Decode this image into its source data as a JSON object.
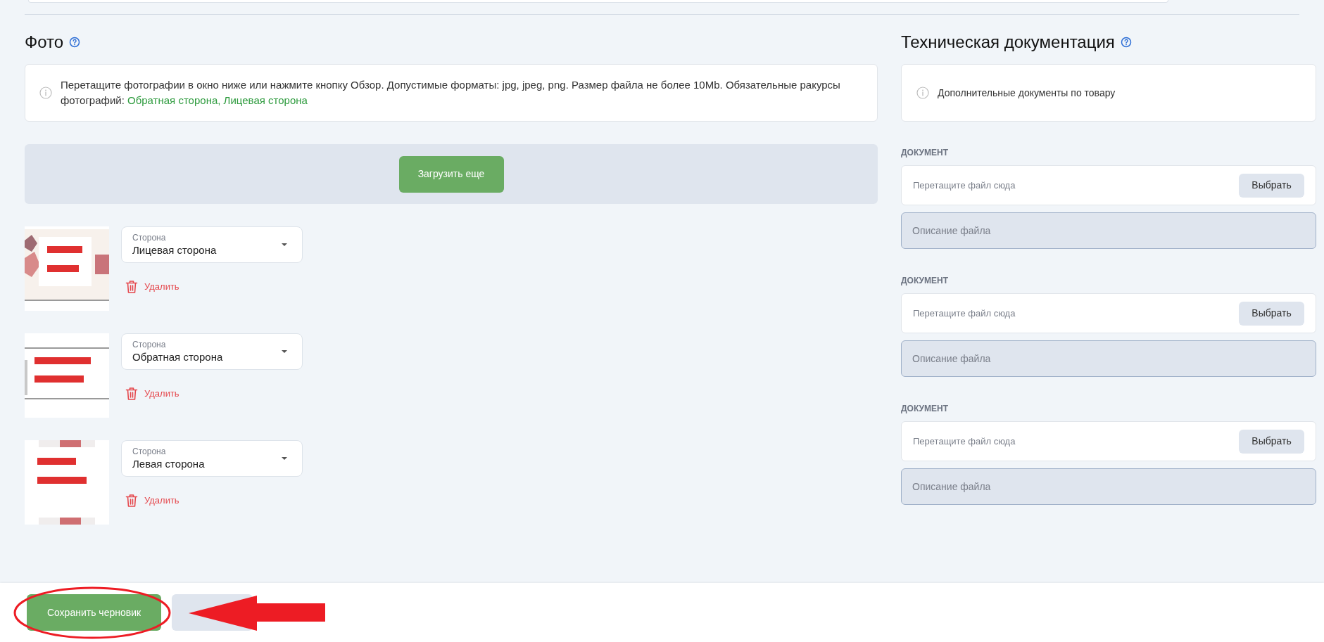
{
  "photo_section": {
    "title": "Фото",
    "info": "Перетащите фотографии в окно ниже или нажмите кнопку Обзор. Допустимые форматы: jpg, jpeg, png. Размер файла не более 10Mb. Обязательные ракурсы фотографий: ",
    "required_views": "Обратная сторона, Лицевая сторона",
    "upload_button": "Загрузить еще",
    "photos": [
      {
        "side_label": "Сторона",
        "side_value": "Лицевая сторона",
        "delete": "Удалить"
      },
      {
        "side_label": "Сторона",
        "side_value": "Обратная сторона",
        "delete": "Удалить"
      },
      {
        "side_label": "Сторона",
        "side_value": "Левая сторона",
        "delete": "Удалить"
      }
    ]
  },
  "docs_section": {
    "title": "Техническая документация",
    "info": "Дополнительные документы по товару",
    "documents": [
      {
        "label": "ДОКУМЕНТ",
        "drop_placeholder": "Перетащите файл сюда",
        "choose_button": "Выбрать",
        "description_placeholder": "Описание файла"
      },
      {
        "label": "ДОКУМЕНТ",
        "drop_placeholder": "Перетащите файл сюда",
        "choose_button": "Выбрать",
        "description_placeholder": "Описание файла"
      },
      {
        "label": "ДОКУМЕНТ",
        "drop_placeholder": "Перетащите файл сюда",
        "choose_button": "Выбрать",
        "description_placeholder": "Описание файла"
      }
    ]
  },
  "footer": {
    "save_draft_button": "Сохранить черновик"
  },
  "annotations": [
    {
      "kind": "ellipse",
      "color": "#ed1c24"
    },
    {
      "kind": "arrow",
      "color": "#ed1c24"
    }
  ]
}
